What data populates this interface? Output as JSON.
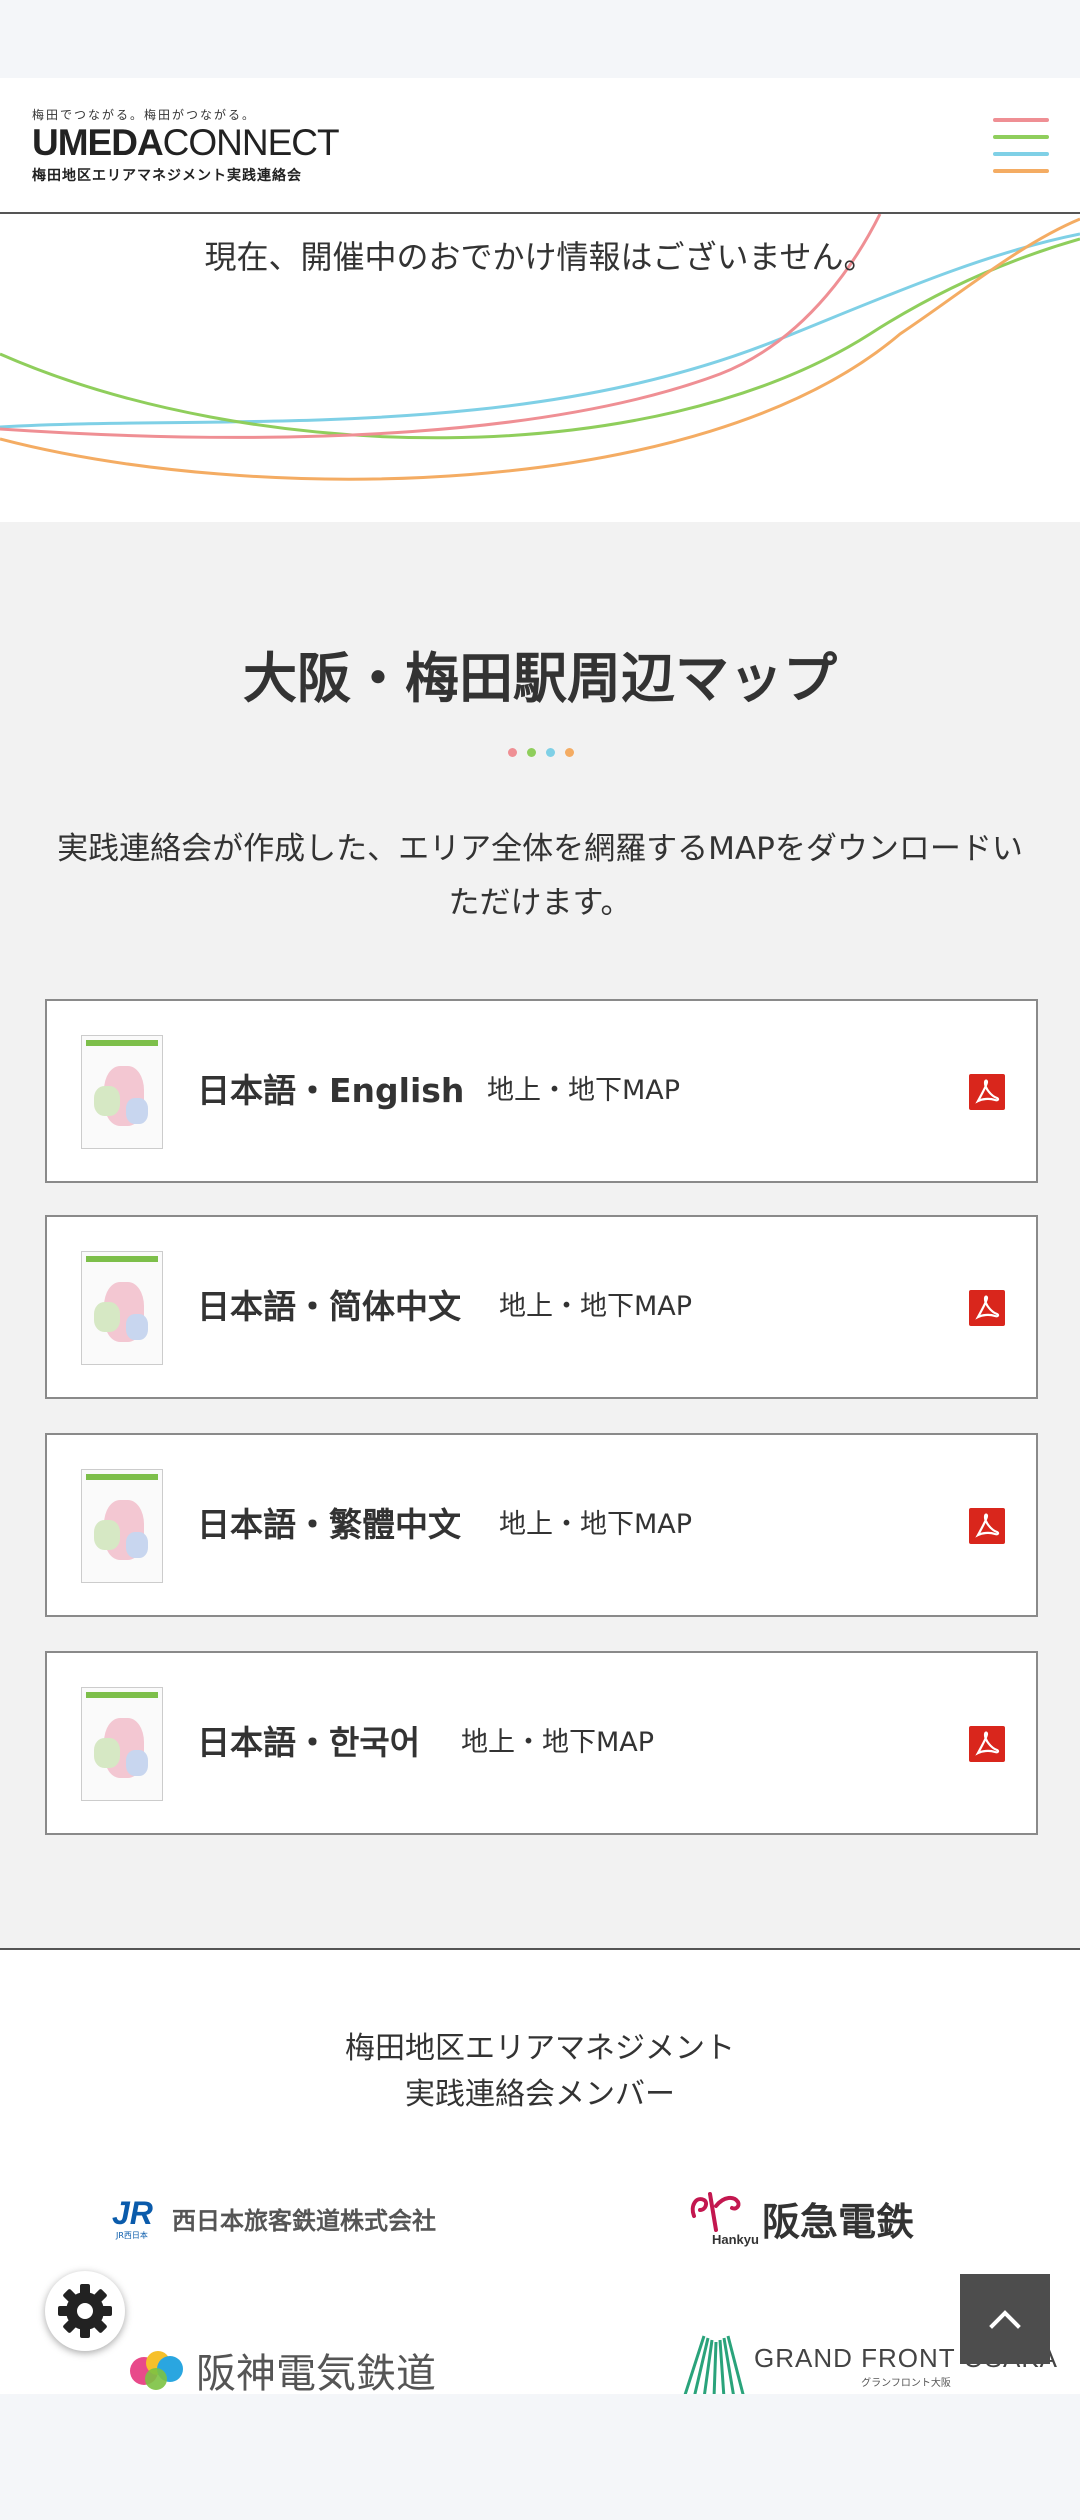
{
  "header": {
    "tagline": "梅田でつながる。梅田がつながる。",
    "brand_bold": "UMEDA",
    "brand_thin": "CONNECT",
    "subtitle": "梅田地区エリアマネジメント実践連絡会",
    "menu_colors": [
      "#ef8f94",
      "#8fce5c",
      "#7fd0e6",
      "#f4ac63"
    ]
  },
  "hero": {
    "notice": "現在、開催中のおでかけ情報はございません。"
  },
  "maps": {
    "title": "大阪・梅田駅周辺マップ",
    "dot_colors": [
      "#ef8f94",
      "#8fce5c",
      "#7fd0e6",
      "#f4ac63"
    ],
    "lead": "実践連絡会が作成した、エリア全体を網羅するMAPをダウンロードいただけます。",
    "items": [
      {
        "title": "日本語・English",
        "type": "地上・地下MAP"
      },
      {
        "title": "日本語・简体中文",
        "type": "地上・地下MAP"
      },
      {
        "title": "日本語・繁體中文",
        "type": "地上・地下MAP"
      },
      {
        "title": "日本語・한국어",
        "type": "地上・地下MAP"
      }
    ],
    "pdf_color": "#d9261c"
  },
  "members": {
    "title_line1": "梅田地区エリアマネジメント",
    "title_line2": "実践連絡会メンバー",
    "logos": [
      {
        "mark": "JR",
        "mark_sub": "JR西日本",
        "name": "西日本旅客鉄道株式会社",
        "color": "#0a5bab"
      },
      {
        "mark": "Hankyu",
        "name": "阪急電鉄",
        "color": "#c3174f"
      },
      {
        "name": "阪神電気鉄道",
        "color": "#555555"
      },
      {
        "name": "GRAND FRONT OSAKA",
        "sub": "グランフロント大阪",
        "color": "#2aa37b"
      }
    ]
  }
}
